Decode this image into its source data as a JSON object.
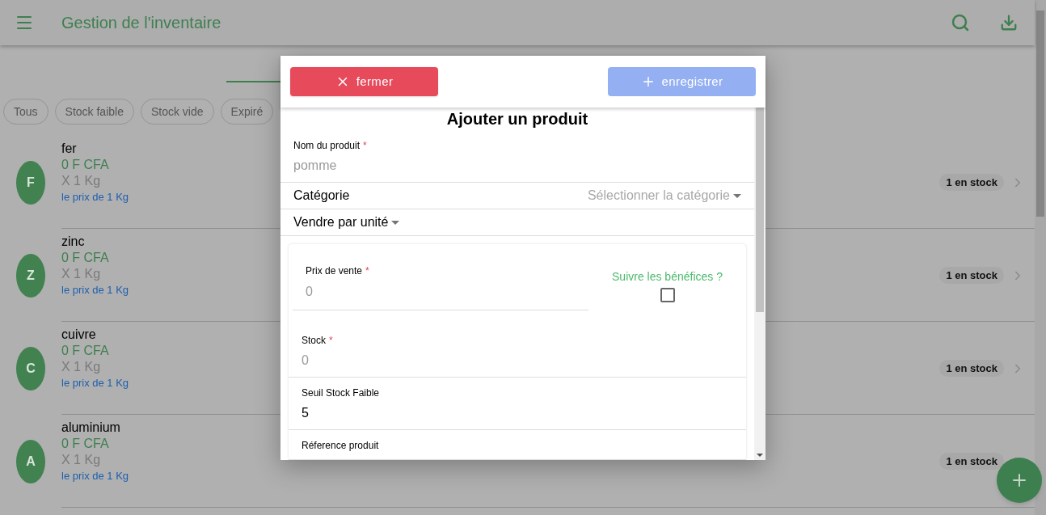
{
  "app_bar": {
    "title": "Gestion de l'inventaire"
  },
  "filters": [
    {
      "label": "Tous",
      "selected": false
    },
    {
      "label": "Stock faible",
      "selected": false
    },
    {
      "label": "Stock vide",
      "selected": false
    },
    {
      "label": "Expiré",
      "selected": false
    }
  ],
  "products": [
    {
      "initial": "F",
      "name": "fer",
      "price": "0 F CFA",
      "unit": "X 1 Kg",
      "note": "le prix de 1 Kg",
      "stock": "1 en stock"
    },
    {
      "initial": "Z",
      "name": "zinc",
      "price": "0 F CFA",
      "unit": "X 1 Kg",
      "note": "le prix de 1 Kg",
      "stock": "1 en stock"
    },
    {
      "initial": "C",
      "name": "cuivre",
      "price": "0 F CFA",
      "unit": "X 1 Kg",
      "note": "le prix de 1 Kg",
      "stock": "1 en stock"
    },
    {
      "initial": "A",
      "name": "aluminium",
      "price": "0 F CFA",
      "unit": "X 1 Kg",
      "note": "le prix de 1 Kg",
      "stock": "1 en stock"
    }
  ],
  "dialog": {
    "required_mark": "*",
    "close_button": "fermer",
    "save_button": {
      "label": "enregistrer",
      "disabled": true
    },
    "title": "Ajouter un produit",
    "name_field": {
      "label": "Nom du produit",
      "required": true,
      "placeholder": "pomme"
    },
    "category": {
      "label": "Catégorie",
      "placeholder": "Sélectionner la catégorie"
    },
    "sell_by": {
      "label": "Vendre par unité"
    },
    "price_field": {
      "label": "Prix de vente",
      "required": true,
      "placeholder": "0"
    },
    "track_profit": {
      "label": "Suivre les bénéfices ?",
      "checked": false
    },
    "fields": [
      {
        "label": "Stock",
        "required": true,
        "placeholder": "0"
      },
      {
        "label": "Seuil Stock Faible",
        "required": false,
        "value": "5"
      },
      {
        "label": "Réference produit",
        "required": false
      }
    ]
  }
}
